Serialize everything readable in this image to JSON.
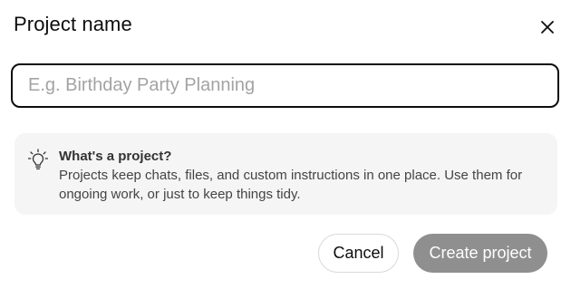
{
  "dialog": {
    "title": "Project name",
    "close_icon": "close-icon"
  },
  "name_input": {
    "value": "",
    "placeholder": "E.g. Birthday Party Planning"
  },
  "info": {
    "icon": "lightbulb-icon",
    "title": "What's a project?",
    "body": "Projects keep chats, files, and custom instructions in one place. Use them for ongoing work, or just to keep things tidy."
  },
  "actions": {
    "cancel_label": "Cancel",
    "create_label": "Create project"
  },
  "colors": {
    "create_button_disabled": "#8f8f8f",
    "info_background": "#f5f5f5",
    "input_border": "#0d0d0d"
  }
}
